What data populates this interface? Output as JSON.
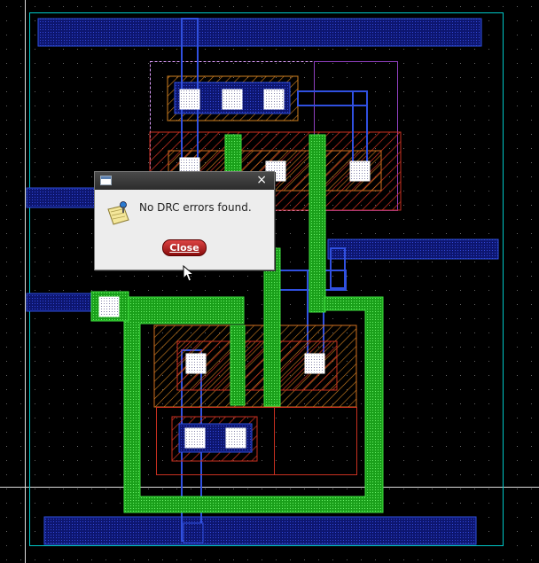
{
  "dialog": {
    "title": "",
    "message": "No DRC errors found.",
    "close_button_label": "Close",
    "close_glyph": "×",
    "icon": "note-icon"
  },
  "colors": {
    "background": "#000000",
    "boundary": "#00cccc",
    "metal1": "#1a2a9a",
    "poly": "#22cc22",
    "active": "#cc3322",
    "contact": "#ffffff",
    "button": "#b01818"
  }
}
